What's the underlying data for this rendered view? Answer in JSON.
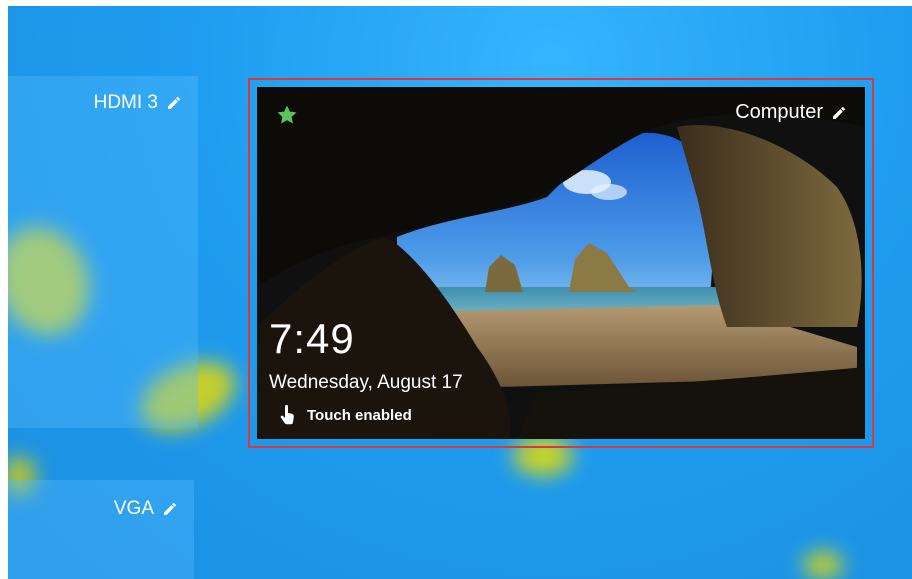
{
  "inputs": [
    {
      "id": "hdmi3",
      "label": "HDMI 3",
      "edit_icon": "pencil-icon"
    },
    {
      "id": "vga",
      "label": "VGA",
      "edit_icon": "pencil-icon"
    }
  ],
  "selected_input": {
    "label": "Computer",
    "edit_icon": "pencil-icon",
    "favorite_icon": "star-icon",
    "favorite_color": "#5cc35a",
    "selection_border_color": "#d63a3a",
    "lock_screen": {
      "time": "7:49",
      "date": "Wednesday, August 17",
      "touch_icon": "touch-hand-icon",
      "touch_status": "Touch enabled"
    }
  },
  "colors": {
    "background_blue": "#1f9df0",
    "blob_yellow": "#c6d12c"
  }
}
